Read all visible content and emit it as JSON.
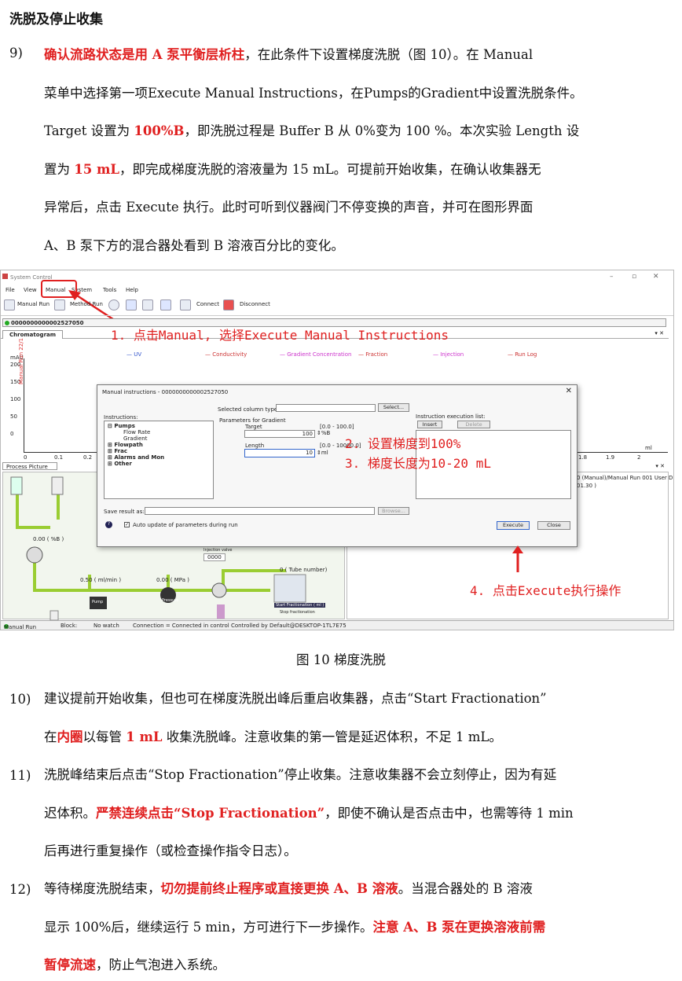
{
  "heading": "洗脱及停止收集",
  "p9": {
    "num": "9)",
    "l1a": "确认流路状态是用 A 泵平衡层析柱",
    "l1b": "，在此条件下设置梯度洗脱（图 10）。在 Manual",
    "l2": "菜单中选择第一项Execute Manual Instructions，在Pumps的Gradient中设置洗脱条件。",
    "l3a": "Target 设置为 ",
    "l3b": "100%B",
    "l3c": "，即洗脱过程是 Buffer B 从 0%变为 100 %。本次实验 Length 设",
    "l4a": "置为 ",
    "l4b": "15 mL",
    "l4c": "，即完成梯度洗脱的溶液量为 15 mL。可提前开始收集，在确认收集器无",
    "l5": "异常后，点击 Execute 执行。此时可听到仪器阀门不停变换的声音，并可在图形界面",
    "l6": "A、B 泵下方的混合器处看到 B 溶液百分比的变化。"
  },
  "screenshot": {
    "window_title": "System Control",
    "menu": [
      "File",
      "View",
      "Manual",
      "System",
      "Tools",
      "Help"
    ],
    "toolbar": {
      "manual_run": "Manual Run",
      "method_run": "Method Run",
      "connect": "Connect",
      "disconnect": "Disconnect"
    },
    "run_id": "0000000000002527050",
    "chrom_tab": "Chromatogram",
    "y_unit": "mAU",
    "y_ticks": [
      "200",
      "150",
      "100",
      "50",
      "0"
    ],
    "y_series": "Manual Run 22/1",
    "x_ticks": [
      "0",
      "0.1",
      "0.2",
      "1.8",
      "1.9",
      "2"
    ],
    "x_unit": "ml",
    "legend": [
      "UV",
      "Conductivity",
      "Gradient Concentration",
      "Fraction",
      "Injection",
      "Run Log"
    ],
    "legend_colors": [
      "#3355cc",
      "#cc3333",
      "#cc33cc",
      "#cc3333",
      "#cc33cc",
      "#cc3333"
    ],
    "process_tab": "Process Picture",
    "right_log": "0 (Manual)/Manual Run 001 User D",
    "right_log2": "01.30 )",
    "status": [
      "Manual Run",
      "Block:",
      "No watch",
      "Connection = Connected in control",
      "Controlled by Default@DESKTOP-1TL7E75"
    ],
    "dialog": {
      "title": "Manual instructions - 0000000000002527050",
      "instructions_label": "Instructions:",
      "tree": [
        "Pumps",
        "Flow Rate",
        "Gradient",
        "Flowpath",
        "Frac",
        "Alarms and Mon",
        "Other"
      ],
      "col_type_label": "Selected column type:",
      "select_btn": "Select...",
      "params_label": "Parameters for Gradient",
      "target_label": "Target",
      "target_range": "[0.0 - 100.0]",
      "target_value": "100",
      "target_unit": "%B",
      "length_label": "Length",
      "length_range": "[0.0 - 10000.0]",
      "length_value": "10",
      "length_unit": "ml",
      "exec_list_label": "Instruction execution list:",
      "insert_btn": "Insert",
      "delete_btn": "Delete",
      "save_label": "Save result as:",
      "browse_btn": "Browse...",
      "auto_update": "Auto update of parameters during run",
      "execute_btn": "Execute",
      "close_btn": "Close"
    },
    "process": {
      "b_pct": "0.00 ( %B )",
      "flow": "0.50 ( ml/min )",
      "pressure": "0.00 ( MPa )",
      "tube": "0 ( Tube number)",
      "start_frac": "Start Fractionation ( ml )",
      "stop_frac": "Stop fractionation",
      "pump": "Pump",
      "pressure_lbl": "Pressure",
      "injection": "Injection valve",
      "inj_value": "0000"
    },
    "annotations": {
      "a1": "1. 点击Manual, 选择Execute Manual Instructions",
      "a2": "2. 设置梯度到100%",
      "a3": "3. 梯度长度为10-20 mL",
      "a4": "4. 点击Execute执行操作"
    }
  },
  "caption": "图 10  梯度洗脱",
  "p10": {
    "num": "10)",
    "l1": "建议提前开始收集，但也可在梯度洗脱出峰后重启收集器，点击“Start Fractionation”",
    "l2a": "在",
    "l2b": "内圈",
    "l2c": "以每管 ",
    "l2d": "1 mL",
    "l2e": " 收集洗脱峰。注意收集的第一管是延迟体积，不足 1 mL。"
  },
  "p11": {
    "num": "11)",
    "l1": "洗脱峰结束后点击“Stop Fractionation”停止收集。注意收集器不会立刻停止，因为有延",
    "l2a": "迟体积。",
    "l2b": "严禁连续点击“Stop Fractionation”",
    "l2c": "，即使不确认是否点击中，也需等待 1 min",
    "l3": "后再进行重复操作（或检查操作指令日志）。"
  },
  "p12": {
    "num": "12)",
    "l1a": "等待梯度洗脱结束，",
    "l1b": "切勿提前终止程序或直接更换 A、B 溶液",
    "l1c": "。当混合器处的 B 溶液",
    "l2a": "显示 100%后，继续运行 5 min，方可进行下一步操作。",
    "l2b": "注意 A、B 泵在更换溶液前需",
    "l3a": "暂停流速",
    "l3b": "，防止气泡进入系统。"
  }
}
